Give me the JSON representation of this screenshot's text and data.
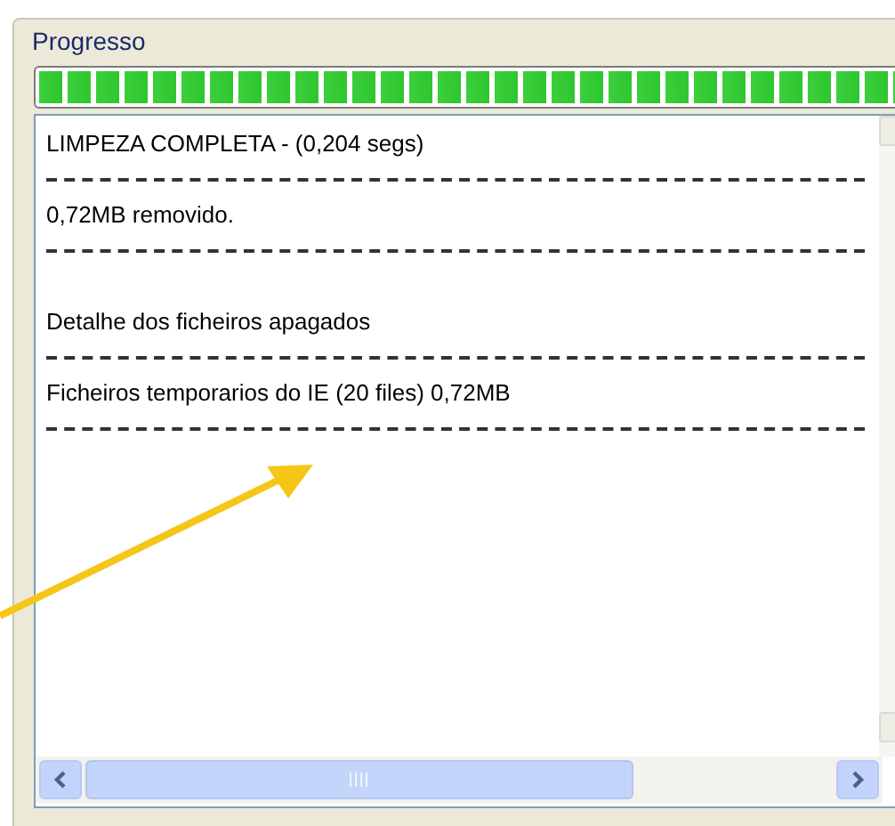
{
  "group": {
    "title": "Progresso"
  },
  "progress": {
    "level": 1
  },
  "log_lines": [
    {
      "kind": "text",
      "text": "LIMPEZA COMPLETA - (0,204 segs)"
    },
    {
      "kind": "separator"
    },
    {
      "kind": "text",
      "text": "0,72MB removido."
    },
    {
      "kind": "separator"
    },
    {
      "kind": "blank"
    },
    {
      "kind": "text",
      "text": "Detalhe dos ficheiros apagados"
    },
    {
      "kind": "separator"
    },
    {
      "kind": "text",
      "text": "Ficheiros temporarios do IE (20 files) 0,72MB"
    },
    {
      "kind": "separator"
    }
  ]
}
